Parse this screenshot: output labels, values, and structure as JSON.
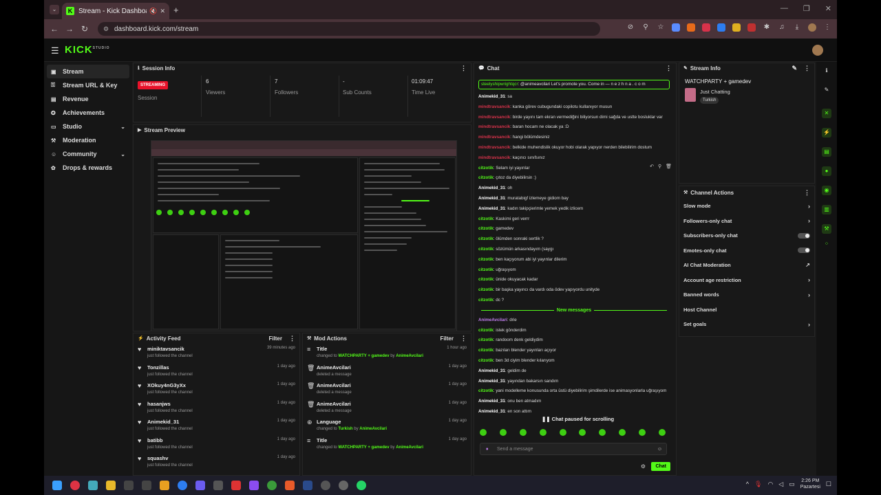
{
  "browser": {
    "tab_title": "Stream - Kick Dashboard",
    "url": "dashboard.kick.com/stream"
  },
  "app": {
    "logo": "KICK"
  },
  "sidebar": {
    "items": [
      {
        "label": "Stream",
        "icon": "stream-icon",
        "active": true
      },
      {
        "label": "Stream URL & Key",
        "icon": "key-icon"
      },
      {
        "label": "Revenue",
        "icon": "revenue-icon"
      },
      {
        "label": "Achievements",
        "icon": "trophy-icon"
      },
      {
        "label": "Studio",
        "icon": "studio-icon",
        "expandable": true
      },
      {
        "label": "Moderation",
        "icon": "shield-icon"
      },
      {
        "label": "Community",
        "icon": "community-icon",
        "expandable": true
      },
      {
        "label": "Drops & rewards",
        "icon": "gift-icon"
      }
    ]
  },
  "session": {
    "title": "Session Info",
    "status": "STREAMING",
    "status_label": "Session",
    "viewers": "6",
    "viewers_label": "Viewers",
    "followers": "7",
    "followers_label": "Followers",
    "subs": "-",
    "subs_label": "Sub Counts",
    "time": "01:09:47",
    "time_label": "Time Live"
  },
  "preview": {
    "title": "Stream Preview"
  },
  "activity": {
    "title": "Activity Feed",
    "filter": "Filter",
    "items": [
      {
        "name": "miniktavsancik",
        "sub": "just followed the channel",
        "time": "39 minutes ago"
      },
      {
        "name": "Tonzillas",
        "sub": "just followed the channel",
        "time": "1 day ago"
      },
      {
        "name": "XOkuy4nG3yXx",
        "sub": "just followed the channel",
        "time": "1 day ago"
      },
      {
        "name": "hasanjws",
        "sub": "just followed the channel",
        "time": "1 day ago"
      },
      {
        "name": "Animekid_31",
        "sub": "just followed the channel",
        "time": "1 day ago"
      },
      {
        "name": "batibb",
        "sub": "just followed the channel",
        "time": "1 day ago"
      },
      {
        "name": "squashv",
        "sub": "just followed the channel",
        "time": "1 day ago"
      }
    ]
  },
  "modactions": {
    "title": "Mod Actions",
    "filter": "Filter",
    "items": [
      {
        "name": "Title",
        "sub_a": "changed to ",
        "sub_b": "WATCHPARTY + gamedev",
        "sub_c": " by ",
        "sub_d": "AnimeAvcilari",
        "time": "1 hour ago",
        "icon": "title-icon"
      },
      {
        "name": "AnimeAvcilari",
        "sub_a": "deleted a message",
        "sub_b": "",
        "sub_c": "",
        "sub_d": "",
        "time": "1 day ago",
        "icon": "trash-icon"
      },
      {
        "name": "AnimeAvcilari",
        "sub_a": "deleted a message",
        "sub_b": "",
        "sub_c": "",
        "sub_d": "",
        "time": "1 day ago",
        "icon": "trash-icon"
      },
      {
        "name": "AnimeAvcilari",
        "sub_a": "deleted a message",
        "sub_b": "",
        "sub_c": "",
        "sub_d": "",
        "time": "1 day ago",
        "icon": "trash-icon"
      },
      {
        "name": "Language",
        "sub_a": "changed to ",
        "sub_b": "Turkish",
        "sub_c": " by ",
        "sub_d": "AnimeAvcilari",
        "time": "1 day ago",
        "icon": "globe-icon"
      },
      {
        "name": "Title",
        "sub_a": "changed to ",
        "sub_b": "WATCHPARTY + gamedev",
        "sub_c": " by ",
        "sub_d": "AnimeAvcilari",
        "time": "1 day ago",
        "icon": "title-icon"
      }
    ]
  },
  "chat": {
    "title": "Chat",
    "pinned_user": "steelyshipwrightqcr",
    "pinned_text": ": @animeavcilari Let's  promote  you. Come in — n e z h n a . c o m",
    "lines": [
      {
        "user": "Animekid_31",
        "color": "u-w",
        "text": ": sa"
      },
      {
        "user": "mindtravsancik",
        "color": "u-r",
        "text": ": kanka görev cubugundaki copilotu kullanıyor musun"
      },
      {
        "user": "mindtravsancik",
        "color": "u-r",
        "text": ": birde yayını tam ekran vermediğini biliyorsun dimi sağda ve ustte bosluklar var"
      },
      {
        "user": "mindtravsancik",
        "color": "u-r",
        "text": ": baran hocam ne olacak ya :D"
      },
      {
        "user": "mindtravsancik",
        "color": "u-r",
        "text": ": hangi bölümdesiniz"
      },
      {
        "user": "mindtravsancik",
        "color": "u-r",
        "text": ": belkide muhendislik okuyor hobi olarak yapıyor nerden bilebilirim dostum"
      },
      {
        "user": "mindtravsancik",
        "color": "u-r",
        "text": ": kaçıncı sınıfsınız"
      },
      {
        "user": "citzotik",
        "color": "u-g",
        "text": ": Selam iyi yayınlar"
      },
      {
        "user": "citzotik",
        "color": "u-g",
        "text": ": çıtoz da diyebilirsin :)"
      },
      {
        "user": "Animekid_31",
        "color": "u-w",
        "text": ": oh"
      },
      {
        "user": "Animekid_31",
        "color": "u-w",
        "text": ": muratabigf izlemeye gidiom bay"
      },
      {
        "user": "Animekid_31",
        "color": "u-w",
        "text": ": kadın takipçierimle yemek yedik izlicem"
      },
      {
        "user": "citzotik",
        "color": "u-g",
        "text": ": Kaskimi geri verrr"
      },
      {
        "user": "citzotik",
        "color": "u-g",
        "text": ": gamedev"
      },
      {
        "user": "citzotik",
        "color": "u-g",
        "text": ": ölümden sonraki sertlik ?"
      },
      {
        "user": "citzotik",
        "color": "u-g",
        "text": ": sözümün arkasındayım (saygı"
      },
      {
        "user": "citzotik",
        "color": "u-g",
        "text": ": ben kaçıyorum abi iyi yayınlar dilerim"
      },
      {
        "user": "citzotik",
        "color": "u-g",
        "text": ": uğraşıyom"
      },
      {
        "user": "citzotik",
        "color": "u-g",
        "text": ": ünide okuyacak kadar"
      },
      {
        "user": "citzotik",
        "color": "u-g",
        "text": ": bir başka yayıncı da vardı oda ödev yapıyordu unityde"
      },
      {
        "user": "citzotik",
        "color": "u-g",
        "text": ": dc ?"
      }
    ],
    "new_messages": "New messages",
    "lines2": [
      {
        "user": "AnimeAvcilari",
        "color": "u-p",
        "text": ": drie"
      },
      {
        "user": "citzotik",
        "color": "u-g",
        "text": ": istek gönderdim"
      },
      {
        "user": "citzotik",
        "color": "u-g",
        "text": ": randoom denk geldiydim"
      },
      {
        "user": "citzotik",
        "color": "u-g",
        "text": ": bazıları blender yayınları açıyor"
      },
      {
        "user": "citzotik",
        "color": "u-g",
        "text": ": ben 3d ciyim blender kılarıyom"
      },
      {
        "user": "Animekid_31",
        "color": "u-w",
        "text": ": geldim de"
      },
      {
        "user": "Animekid_31",
        "color": "u-w",
        "text": ": yayından bakarsın sandım"
      },
      {
        "user": "citzotik",
        "color": "u-g",
        "text": ": yani modelleme konusunda orta üstü diyebilirim şimdilerde ise animasyonlarla uğraşıyom"
      },
      {
        "user": "Animekid_31",
        "color": "u-w",
        "text": ": onu ben atmadım"
      },
      {
        "user": "Animekid_31",
        "color": "u-w",
        "text": ": en son attım"
      }
    ],
    "paused": "Chat paused for scrolling",
    "placeholder": "Send a message",
    "send": "Chat"
  },
  "streaminfo": {
    "title": "Stream Info",
    "stream_title": "WATCHPARTY + gamedev",
    "category": "Just Chatting",
    "tag": "Turkish"
  },
  "channelactions": {
    "title": "Channel Actions",
    "items": [
      {
        "label": "Slow mode",
        "ctrl": "chev"
      },
      {
        "label": "Followers-only chat",
        "ctrl": "chev"
      },
      {
        "label": "Subscribers-only chat",
        "ctrl": "toggle"
      },
      {
        "label": "Emotes-only chat",
        "ctrl": "toggle"
      },
      {
        "label": "AI Chat Moderation",
        "ctrl": "ext"
      },
      {
        "label": "Account age restriction",
        "ctrl": "chev"
      },
      {
        "label": "Banned words",
        "ctrl": "chev"
      },
      {
        "label": "Host Channel",
        "ctrl": "none"
      },
      {
        "label": "Set goals",
        "ctrl": "chev"
      }
    ]
  },
  "taskbar": {
    "time": "2:26 PM",
    "day": "Pazartesi"
  },
  "colors": {
    "accent": "#53fc18",
    "live": "#e8122a"
  }
}
